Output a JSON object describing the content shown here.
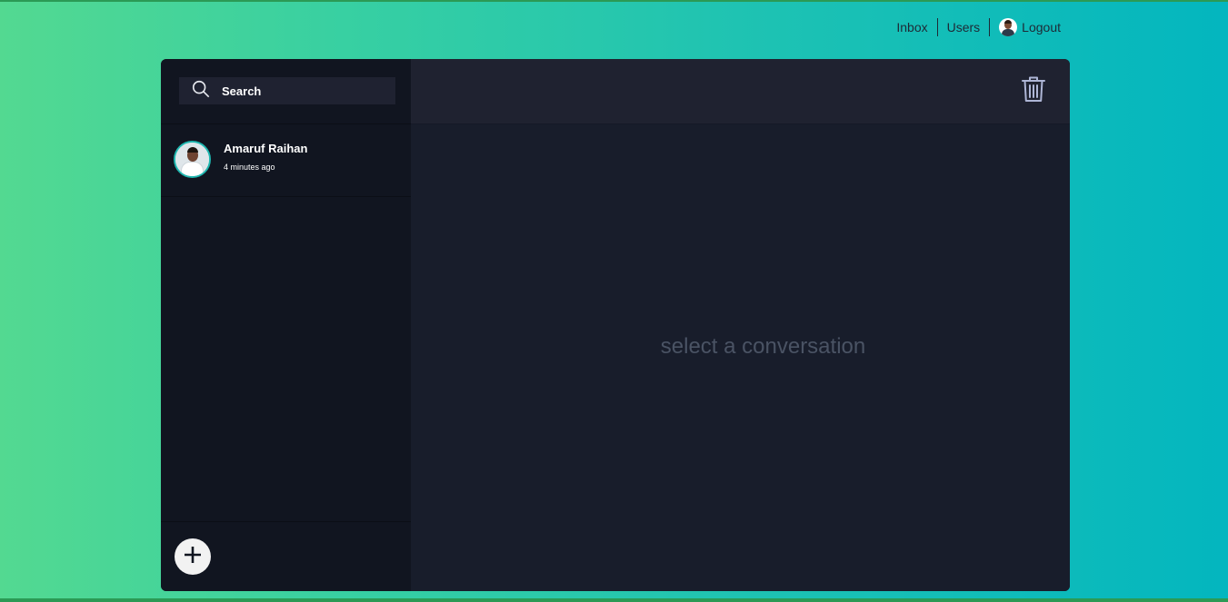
{
  "nav": {
    "inbox_label": "Inbox",
    "users_label": "Users",
    "logout_label": "Logout"
  },
  "search": {
    "placeholder": "Search"
  },
  "conversations": [
    {
      "name": "Amaruf Raihan",
      "time": "4 minutes ago"
    }
  ],
  "main": {
    "empty_message": "select a conversation"
  },
  "icons": {
    "search": "search-icon",
    "trash": "trash-icon",
    "add": "plus-icon"
  },
  "colors": {
    "gradient_start": "#53d991",
    "gradient_end": "#03b6bf",
    "sidebar_bg": "#111520",
    "main_bg": "#181d2b",
    "header_bg": "#1f2230",
    "avatar_ring": "#1fb7b0",
    "empty_text": "#4a5364"
  }
}
